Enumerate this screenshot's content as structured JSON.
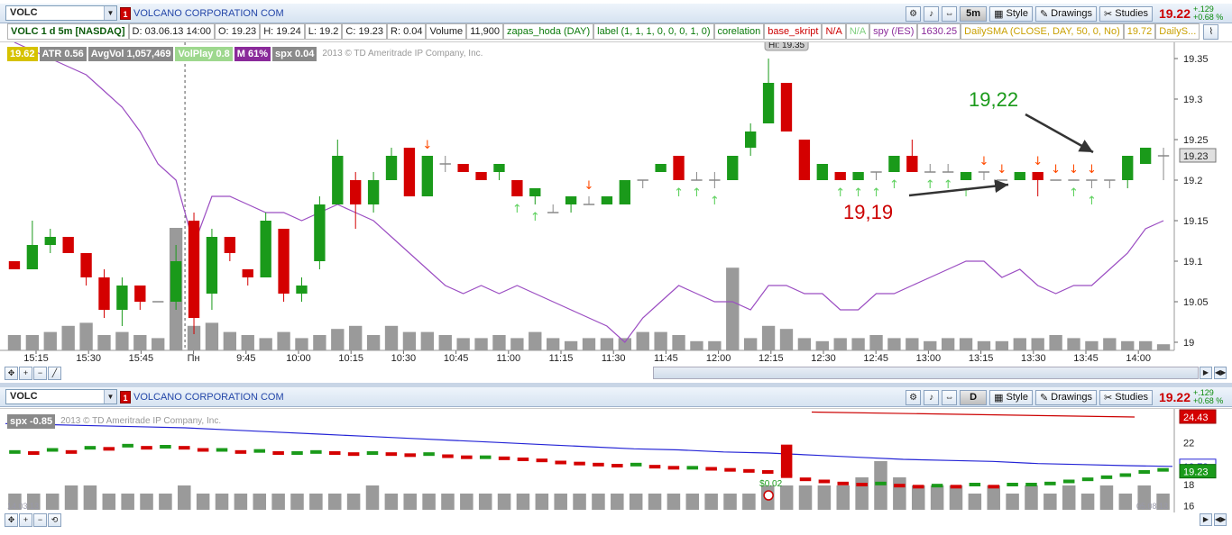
{
  "top": {
    "symbol": "VOLC",
    "badge": "1",
    "company": "VOLCANO CORPORATION COM",
    "period": "5m",
    "style_label": "Style",
    "drawings_label": "Drawings",
    "studies_label": "Studies",
    "price": "19.22",
    "change_abs": "+.129",
    "change_pct": "+0.68 %"
  },
  "infobar": {
    "title": "VOLC 1 d 5m [NASDAQ]",
    "date": "D: 03.06.13 14:00",
    "open": "O: 19.23",
    "high": "H: 19.24",
    "low": "L: 19.2",
    "close": "C: 19.23",
    "range": "R: 0.04",
    "volume_label": "Volume",
    "volume": "11,900",
    "zapas": "zapas_hoda (DAY)",
    "label_study": "label (1, 1, 1, 0, 0, 0, 1, 0)",
    "corelation": "corelation",
    "base": "base_skript",
    "na1": "N/A",
    "na2": "N/A",
    "spy": "spy (/ES)",
    "spy_val": "1630.25",
    "dailysma": "DailySMA (CLOSE, DAY, 50, 0, No)",
    "dailysma_val": "19.72",
    "dailys2": "DailyS..."
  },
  "legend": {
    "price": "19.62",
    "atr": "ATR 0.56",
    "avgvol": "AvgVol 1,057,469",
    "volplay": "VolPlay 0.8",
    "m": "M 61%",
    "spx": "spx 0.04",
    "copyright": "2013 © TD Ameritrade IP Company, Inc."
  },
  "upper_axis": {
    "ticks": [
      "19.35",
      "19.3",
      "19.25",
      "19.2",
      "19.15",
      "19.1",
      "19.05",
      "19"
    ],
    "current": "19.23",
    "hi_label": "Hi: 19.35",
    "times": [
      "15:15",
      "15:30",
      "15:45",
      "Пн",
      "9:45",
      "10:00",
      "10:15",
      "10:30",
      "10:45",
      "11:00",
      "11:15",
      "11:30",
      "11:45",
      "12:00",
      "12:15",
      "12:30",
      "12:45",
      "13:00",
      "13:15",
      "13:30",
      "13:45",
      "14:00"
    ]
  },
  "annotations": {
    "green": "19,22",
    "red": "19,19"
  },
  "lower": {
    "symbol": "VOLC",
    "badge": "1",
    "company": "VOLCANO CORPORATION COM",
    "period": "D",
    "style_label": "Style",
    "drawings_label": "Drawings",
    "studies_label": "Studies",
    "price": "19.22",
    "change_abs": "+.129",
    "change_pct": "+0.68 %",
    "spx": "spx -0.85",
    "copyright": "2013 © TD Ameritrade IP Company, Inc.",
    "ticks": [
      "22",
      "20",
      "18",
      "16"
    ],
    "tag_red": "24.43",
    "tag_blue": "19.73",
    "tag_green": "19.23",
    "dividend": "$0.02",
    "left_date": "14.03.13",
    "right_date": "05.08.13"
  },
  "colors": {
    "up": "#1a9a1a",
    "down": "#d40000",
    "volume": "#9a9a9a",
    "purple_line": "#9b4dc2",
    "sma_blue": "#2424d6"
  },
  "chart_data": [
    {
      "type": "candlestick",
      "title": "VOLC 1 d 5m [NASDAQ]",
      "ylim": [
        19.0,
        19.37
      ],
      "candles": [
        {
          "t": "15:10",
          "o": 19.1,
          "c": 19.09,
          "h": 19.1,
          "l": 19.09
        },
        {
          "t": "15:15",
          "o": 19.09,
          "c": 19.12,
          "h": 19.15,
          "l": 19.09
        },
        {
          "t": "15:20",
          "o": 19.12,
          "c": 19.13,
          "h": 19.14,
          "l": 19.11
        },
        {
          "t": "15:25",
          "o": 19.13,
          "c": 19.11,
          "h": 19.13,
          "l": 19.11
        },
        {
          "t": "15:30",
          "o": 19.11,
          "c": 19.08,
          "h": 19.11,
          "l": 19.07
        },
        {
          "t": "15:35",
          "o": 19.08,
          "c": 19.04,
          "h": 19.09,
          "l": 19.03
        },
        {
          "t": "15:40",
          "o": 19.04,
          "c": 19.07,
          "h": 19.08,
          "l": 19.02
        },
        {
          "t": "15:45",
          "o": 19.07,
          "c": 19.05,
          "h": 19.07,
          "l": 19.04
        },
        {
          "t": "15:50",
          "o": 19.05,
          "c": 19.05,
          "h": 19.05,
          "l": 19.05
        },
        {
          "t": "15:55",
          "o": 19.05,
          "c": 19.1,
          "h": 19.12,
          "l": 19.04
        },
        {
          "t": "9:35",
          "o": 19.15,
          "c": 19.03,
          "h": 19.16,
          "l": 19.01
        },
        {
          "t": "9:40",
          "o": 19.06,
          "c": 19.13,
          "h": 19.14,
          "l": 19.04
        },
        {
          "t": "9:45",
          "o": 19.13,
          "c": 19.11,
          "h": 19.13,
          "l": 19.1
        },
        {
          "t": "9:50",
          "o": 19.09,
          "c": 19.08,
          "h": 19.09,
          "l": 19.07
        },
        {
          "t": "9:55",
          "o": 19.08,
          "c": 19.15,
          "h": 19.16,
          "l": 19.08
        },
        {
          "t": "10:00",
          "o": 19.14,
          "c": 19.06,
          "h": 19.14,
          "l": 19.05
        },
        {
          "t": "10:05",
          "o": 19.06,
          "c": 19.07,
          "h": 19.08,
          "l": 19.05
        },
        {
          "t": "10:10",
          "o": 19.1,
          "c": 19.17,
          "h": 19.18,
          "l": 19.09
        },
        {
          "t": "10:15",
          "o": 19.17,
          "c": 19.23,
          "h": 19.25,
          "l": 19.17
        },
        {
          "t": "10:20",
          "o": 19.2,
          "c": 19.17,
          "h": 19.21,
          "l": 19.14
        },
        {
          "t": "10:25",
          "o": 19.17,
          "c": 19.2,
          "h": 19.21,
          "l": 19.16
        },
        {
          "t": "10:30",
          "o": 19.2,
          "c": 19.23,
          "h": 19.24,
          "l": 19.2
        },
        {
          "t": "10:35",
          "o": 19.24,
          "c": 19.18,
          "h": 19.24,
          "l": 19.18
        },
        {
          "t": "10:40",
          "o": 19.18,
          "c": 19.23,
          "h": 19.23,
          "l": 19.18
        },
        {
          "t": "10:45",
          "o": 19.22,
          "c": 19.22,
          "h": 19.23,
          "l": 19.21
        },
        {
          "t": "10:50",
          "o": 19.22,
          "c": 19.21,
          "h": 19.22,
          "l": 19.21
        },
        {
          "t": "10:55",
          "o": 19.21,
          "c": 19.2,
          "h": 19.21,
          "l": 19.2
        },
        {
          "t": "11:00",
          "o": 19.21,
          "c": 19.22,
          "h": 19.22,
          "l": 19.2
        },
        {
          "t": "11:05",
          "o": 19.2,
          "c": 19.18,
          "h": 19.2,
          "l": 19.18
        },
        {
          "t": "11:10",
          "o": 19.18,
          "c": 19.19,
          "h": 19.19,
          "l": 19.17
        },
        {
          "t": "11:15",
          "o": 19.16,
          "c": 19.16,
          "h": 19.17,
          "l": 19.16
        },
        {
          "t": "11:20",
          "o": 19.17,
          "c": 19.18,
          "h": 19.18,
          "l": 19.16
        },
        {
          "t": "11:25",
          "o": 19.17,
          "c": 19.17,
          "h": 19.18,
          "l": 19.17
        },
        {
          "t": "11:30",
          "o": 19.17,
          "c": 19.18,
          "h": 19.18,
          "l": 19.17
        },
        {
          "t": "11:35",
          "o": 19.17,
          "c": 19.2,
          "h": 19.2,
          "l": 19.17
        },
        {
          "t": "11:40",
          "o": 19.2,
          "c": 19.2,
          "h": 19.2,
          "l": 19.19
        },
        {
          "t": "11:45",
          "o": 19.21,
          "c": 19.22,
          "h": 19.22,
          "l": 19.21
        },
        {
          "t": "11:50",
          "o": 19.23,
          "c": 19.2,
          "h": 19.23,
          "l": 19.2
        },
        {
          "t": "11:55",
          "o": 19.2,
          "c": 19.2,
          "h": 19.21,
          "l": 19.2
        },
        {
          "t": "12:00",
          "o": 19.2,
          "c": 19.2,
          "h": 19.21,
          "l": 19.19
        },
        {
          "t": "12:05",
          "o": 19.2,
          "c": 19.23,
          "h": 19.23,
          "l": 19.2
        },
        {
          "t": "12:10",
          "o": 19.24,
          "c": 19.26,
          "h": 19.27,
          "l": 19.23
        },
        {
          "t": "12:15",
          "o": 19.27,
          "c": 19.32,
          "h": 19.35,
          "l": 19.27
        },
        {
          "t": "12:20",
          "o": 19.32,
          "c": 19.26,
          "h": 19.32,
          "l": 19.26
        },
        {
          "t": "12:25",
          "o": 19.25,
          "c": 19.2,
          "h": 19.25,
          "l": 19.2
        },
        {
          "t": "12:30",
          "o": 19.2,
          "c": 19.22,
          "h": 19.22,
          "l": 19.2
        },
        {
          "t": "12:35",
          "o": 19.21,
          "c": 19.2,
          "h": 19.21,
          "l": 19.2
        },
        {
          "t": "12:40",
          "o": 19.2,
          "c": 19.21,
          "h": 19.21,
          "l": 19.2
        },
        {
          "t": "12:45",
          "o": 19.21,
          "c": 19.21,
          "h": 19.21,
          "l": 19.2
        },
        {
          "t": "12:50",
          "o": 19.21,
          "c": 19.23,
          "h": 19.23,
          "l": 19.21
        },
        {
          "t": "12:55",
          "o": 19.23,
          "c": 19.21,
          "h": 19.25,
          "l": 19.21
        },
        {
          "t": "13:00",
          "o": 19.21,
          "c": 19.21,
          "h": 19.22,
          "l": 19.21
        },
        {
          "t": "13:05",
          "o": 19.21,
          "c": 19.21,
          "h": 19.22,
          "l": 19.21
        },
        {
          "t": "13:10",
          "o": 19.2,
          "c": 19.21,
          "h": 19.21,
          "l": 19.2
        },
        {
          "t": "13:15",
          "o": 19.21,
          "c": 19.21,
          "h": 19.21,
          "l": 19.2
        },
        {
          "t": "13:20",
          "o": 19.2,
          "c": 19.2,
          "h": 19.2,
          "l": 19.2
        },
        {
          "t": "13:25",
          "o": 19.2,
          "c": 19.21,
          "h": 19.21,
          "l": 19.2
        },
        {
          "t": "13:30",
          "o": 19.21,
          "c": 19.2,
          "h": 19.21,
          "l": 19.18
        },
        {
          "t": "13:35",
          "o": 19.2,
          "c": 19.2,
          "h": 19.2,
          "l": 19.2
        },
        {
          "t": "13:40",
          "o": 19.2,
          "c": 19.2,
          "h": 19.2,
          "l": 19.2
        },
        {
          "t": "13:45",
          "o": 19.2,
          "c": 19.2,
          "h": 19.2,
          "l": 19.19
        },
        {
          "t": "13:50",
          "o": 19.2,
          "c": 19.2,
          "h": 19.2,
          "l": 19.19
        },
        {
          "t": "13:55",
          "o": 19.2,
          "c": 19.23,
          "h": 19.23,
          "l": 19.19
        },
        {
          "t": "14:00",
          "o": 19.22,
          "c": 19.24,
          "h": 19.24,
          "l": 19.22
        },
        {
          "t": "14:05",
          "o": 19.23,
          "c": 19.23,
          "h": 19.24,
          "l": 19.2
        }
      ],
      "volume": [
        5,
        5,
        6,
        8,
        9,
        5,
        6,
        5,
        4,
        40,
        8,
        9,
        6,
        5,
        4,
        6,
        4,
        5,
        7,
        8,
        5,
        8,
        6,
        6,
        5,
        4,
        4,
        5,
        4,
        6,
        4,
        3,
        4,
        4,
        4,
        6,
        6,
        5,
        3,
        3,
        27,
        4,
        8,
        7,
        4,
        3,
        4,
        4,
        5,
        4,
        4,
        3,
        4,
        4,
        3,
        3,
        4,
        4,
        5,
        4,
        3,
        4,
        3,
        3,
        2
      ],
      "purple_line": [
        19.37,
        19.36,
        19.35,
        19.34,
        19.33,
        19.31,
        19.29,
        19.26,
        19.22,
        19.2,
        19.12,
        19.18,
        19.18,
        19.17,
        19.16,
        19.16,
        19.15,
        19.16,
        19.17,
        19.16,
        19.15,
        19.13,
        19.11,
        19.09,
        19.07,
        19.06,
        19.07,
        19.06,
        19.07,
        19.06,
        19.05,
        19.04,
        19.03,
        19.02,
        19.0,
        19.03,
        19.05,
        19.07,
        19.06,
        19.05,
        19.05,
        19.04,
        19.07,
        19.07,
        19.06,
        19.06,
        19.04,
        19.04,
        19.06,
        19.06,
        19.07,
        19.08,
        19.09,
        19.1,
        19.1,
        19.08,
        19.09,
        19.07,
        19.06,
        19.07,
        19.07,
        19.09,
        19.11,
        19.14,
        19.15
      ],
      "down_arrows": [
        "10:40",
        "11:25",
        "13:15",
        "13:20",
        "13:30",
        "13:35",
        "13:40",
        "13:45"
      ],
      "up_arrows": [
        "11:05",
        "11:10",
        "11:50",
        "11:55",
        "12:00",
        "12:35",
        "12:40",
        "12:45",
        "12:50",
        "13:00",
        "13:05",
        "13:10",
        "13:40",
        "13:45"
      ]
    },
    {
      "type": "candlestick",
      "title": "VOLC D",
      "ylim": [
        16,
        25
      ],
      "closes": [
        21.1,
        21.0,
        21.3,
        21.1,
        21.5,
        21.4,
        21.7,
        21.5,
        21.6,
        21.5,
        21.3,
        21.3,
        21.1,
        21.2,
        21.0,
        21.0,
        21.1,
        21.0,
        20.9,
        21.0,
        20.9,
        20.8,
        20.9,
        20.7,
        20.6,
        20.6,
        20.5,
        20.4,
        20.3,
        20.1,
        20.0,
        19.9,
        19.8,
        19.9,
        19.7,
        19.6,
        19.6,
        19.5,
        19.4,
        19.3,
        19.2,
        18.8,
        18.5,
        18.3,
        18.1,
        18.0,
        18.1,
        17.9,
        17.8,
        17.9,
        17.8,
        18.0,
        17.8,
        18.0,
        18.0,
        18.1,
        18.3,
        18.5,
        18.7,
        18.9,
        19.2,
        19.4
      ],
      "sma_blue": [
        23.8,
        23.7,
        23.6,
        23.5,
        23.4,
        23.2,
        23.0,
        22.8,
        22.6,
        22.4,
        22.2,
        22.0,
        21.8,
        21.6,
        21.4,
        21.3,
        21.1,
        21.0,
        20.8,
        20.6,
        20.4,
        20.3,
        20.2,
        20.0,
        19.9,
        19.8,
        19.73
      ],
      "sma_red": [
        24.9,
        24.43
      ],
      "volume": [
        2,
        2,
        2,
        3,
        3,
        2,
        2,
        2,
        2,
        3,
        2,
        2,
        2,
        2,
        2,
        2,
        2,
        2,
        2,
        3,
        2,
        2,
        2,
        2,
        2,
        2,
        2,
        2,
        2,
        2,
        2,
        2,
        2,
        2,
        2,
        2,
        2,
        2,
        2,
        2,
        3,
        3,
        3,
        3,
        3,
        4,
        6,
        4,
        3,
        3,
        3,
        2,
        3,
        2,
        3,
        2,
        3,
        2,
        3,
        2,
        3,
        2
      ]
    }
  ]
}
